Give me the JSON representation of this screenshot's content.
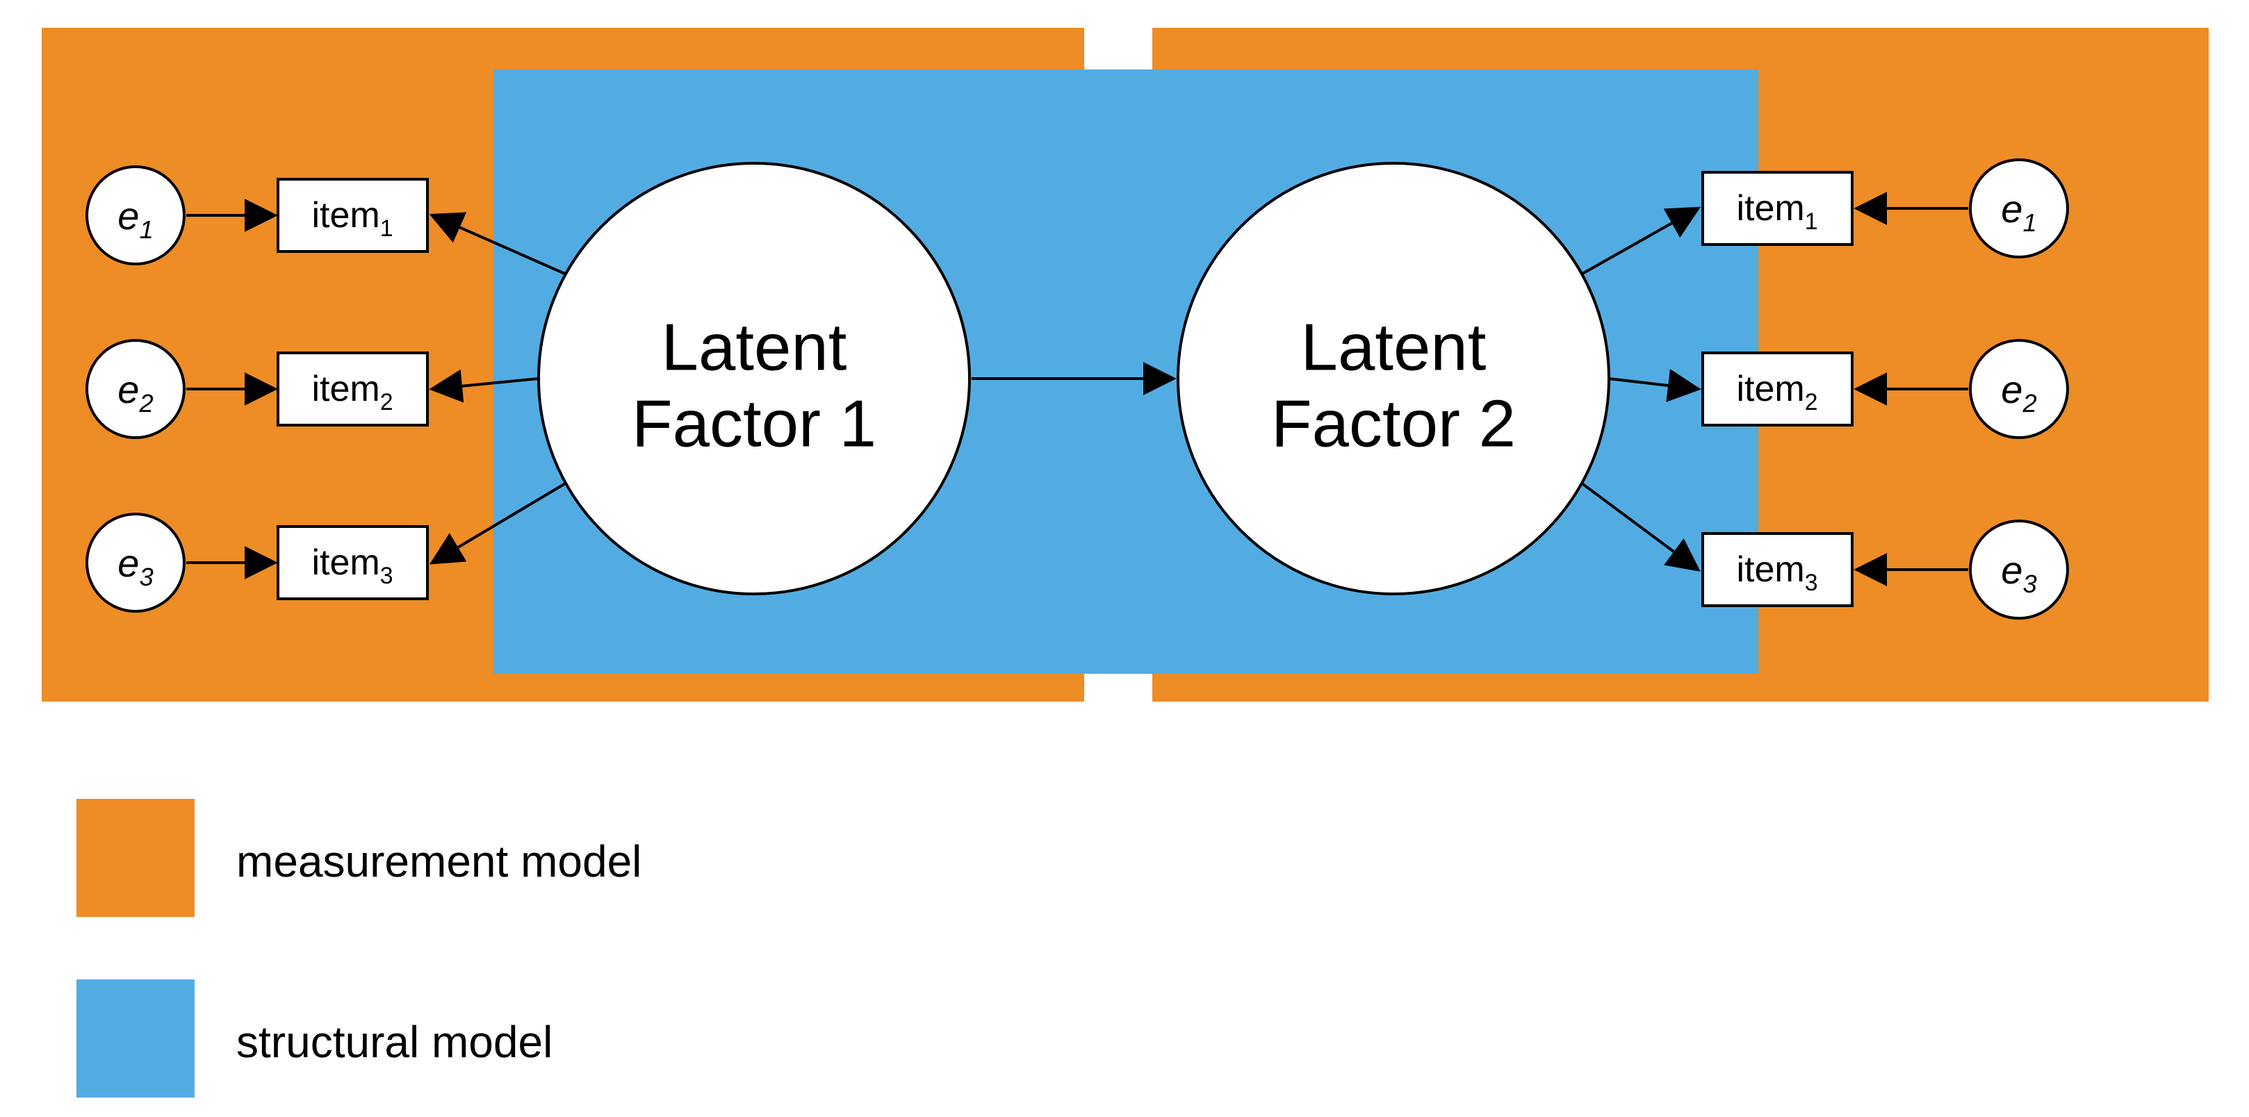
{
  "colors": {
    "orange": "#ee8c25",
    "blue": "#52ace2",
    "white": "#ffffff",
    "black": "#000000"
  },
  "latent": {
    "factor1": {
      "line1": "Latent",
      "line2": "Factor 1"
    },
    "factor2": {
      "line1": "Latent",
      "line2": "Factor 2"
    }
  },
  "left": {
    "errors": [
      {
        "label": "e",
        "sub": "1"
      },
      {
        "label": "e",
        "sub": "2"
      },
      {
        "label": "e",
        "sub": "3"
      }
    ],
    "items": [
      {
        "label": "item",
        "sub": "1"
      },
      {
        "label": "item",
        "sub": "2"
      },
      {
        "label": "item",
        "sub": "3"
      }
    ]
  },
  "right": {
    "items": [
      {
        "label": "item",
        "sub": "1"
      },
      {
        "label": "item",
        "sub": "2"
      },
      {
        "label": "item",
        "sub": "3"
      }
    ],
    "errors": [
      {
        "label": "e",
        "sub": "1"
      },
      {
        "label": "e",
        "sub": "2"
      },
      {
        "label": "e",
        "sub": "3"
      }
    ]
  },
  "legend": {
    "measurement": "measurement model",
    "structural": "structural model"
  }
}
